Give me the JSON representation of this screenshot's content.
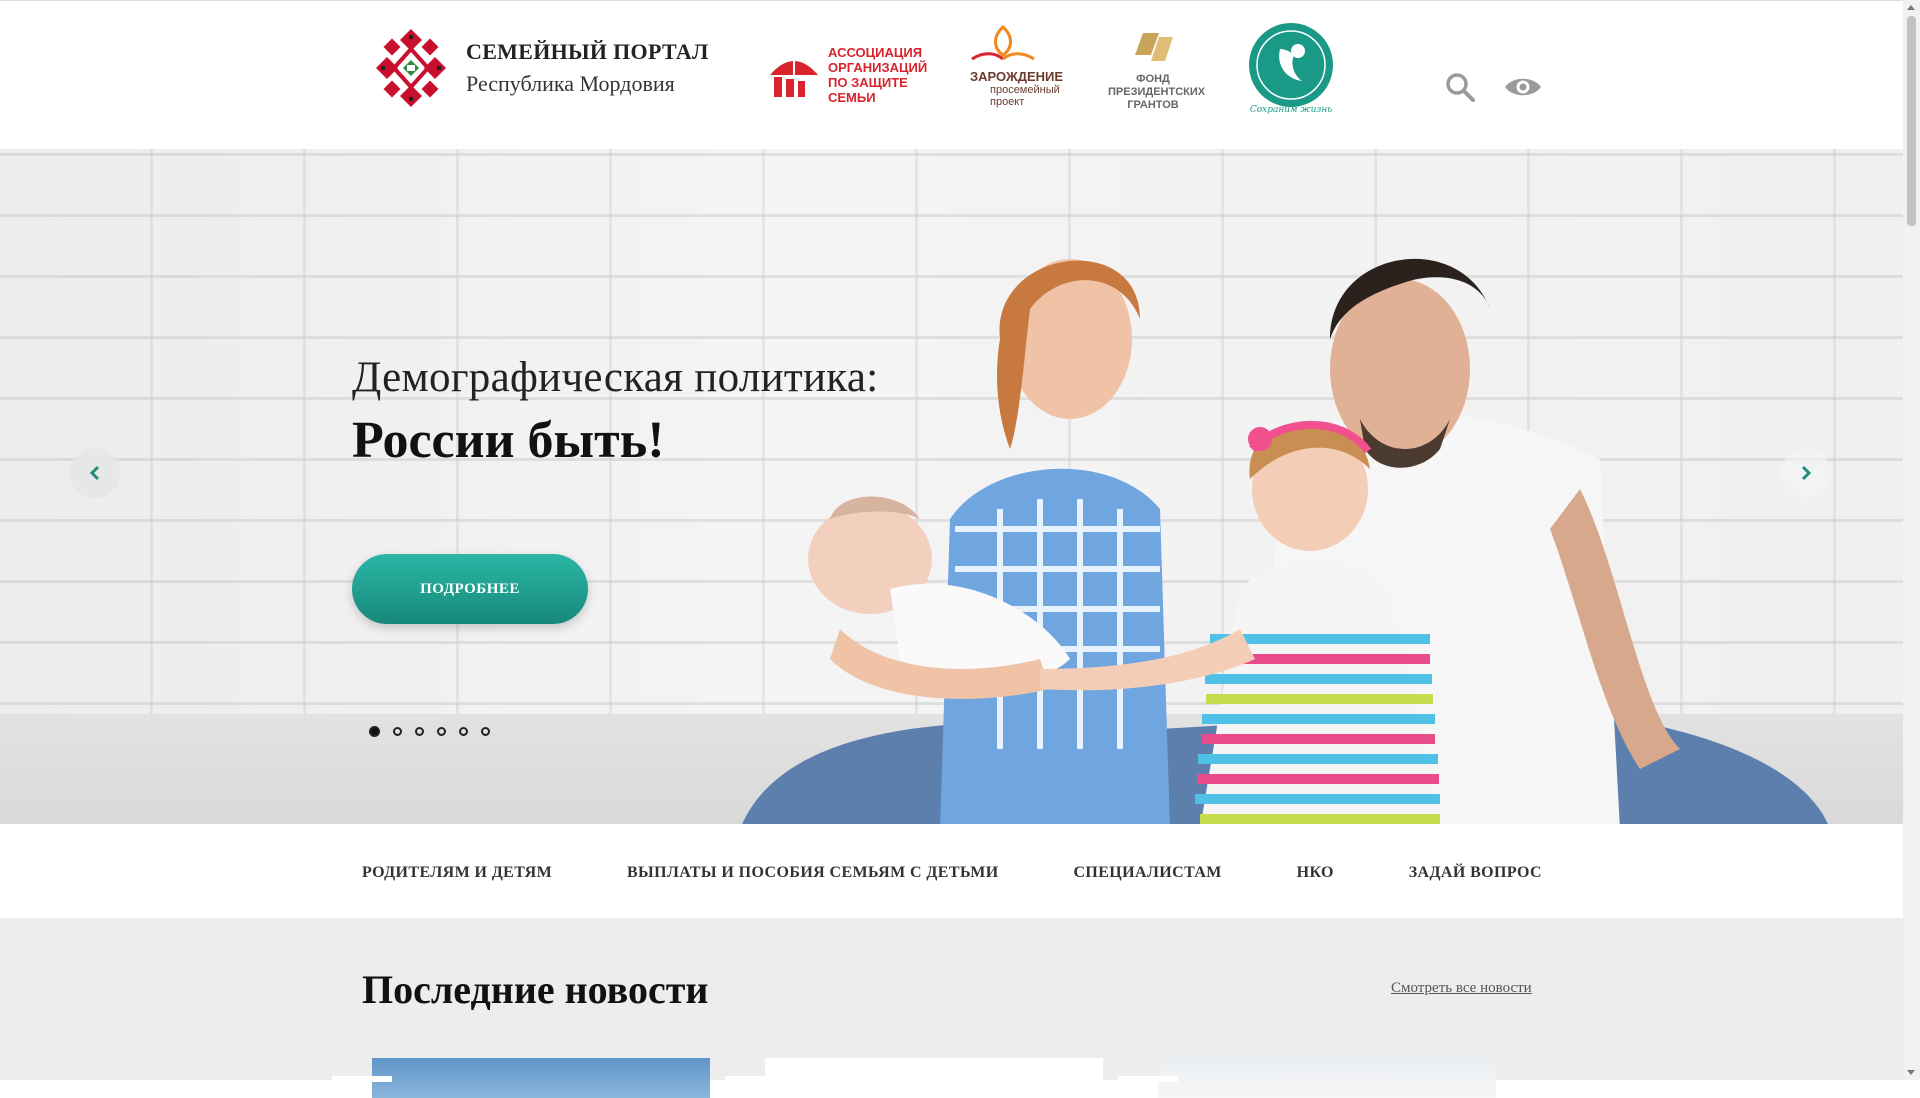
{
  "header": {
    "brand_title": "СЕМЕЙНЫЙ ПОРТАЛ",
    "brand_subtitle": "Республика Мордовия",
    "partners": {
      "association": "АССОЦИАЦИЯ ОРГАНИЗАЦИЙ ПО ЗАЩИТЕ СЕМЬИ",
      "zarozhdenie_title": "ЗАРОЖДЕНИЕ",
      "zarozhdenie_sub": "просемейный проект",
      "fond": "ФОНД ПРЕЗИДЕНТСКИХ ГРАНТОВ",
      "save_life_text": "Сохраним жизнь"
    },
    "icons": [
      "search-icon",
      "eye-icon"
    ]
  },
  "hero": {
    "title": "Демографическая политика:",
    "title_bold": "России быть!",
    "button_label": "ПОДРОБНЕЕ",
    "slides_total": 6,
    "active_slide": 1
  },
  "nav": {
    "items": [
      "РОДИТЕЛЯМ И ДЕТЯМ",
      "ВЫПЛАТЫ И ПОСОБИЯ СЕМЬЯМ С ДЕТЬМИ",
      "СПЕЦИАЛИСТАМ",
      "НКО",
      "ЗАДАЙ ВОПРОС"
    ]
  },
  "news": {
    "title": "Последние новости",
    "all_link": "Смотреть все новости"
  },
  "colors": {
    "accent": "#1fa595",
    "association_red": "#d9232d",
    "life_green": "#1a9a86"
  }
}
